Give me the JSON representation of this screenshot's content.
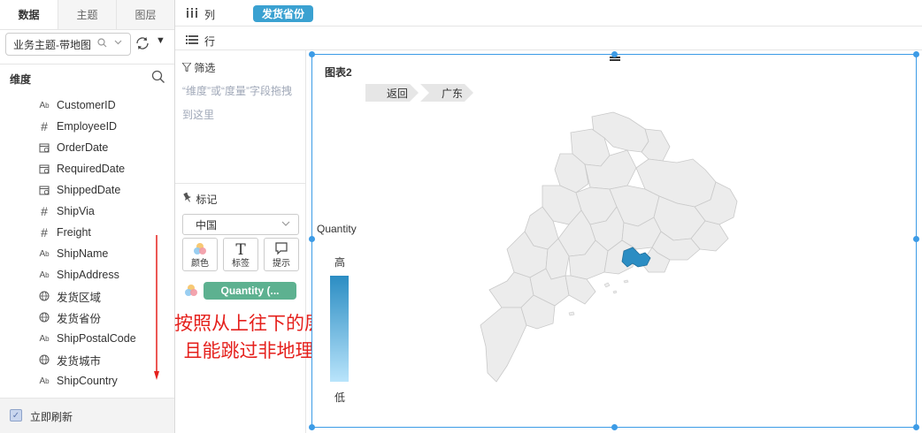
{
  "tabs": [
    "数据",
    "主题",
    "图层"
  ],
  "theme_select": {
    "value": "业务主题-带地图"
  },
  "dimension_header": "维度",
  "fields": [
    {
      "icon": "text-field-icon",
      "glyph": "Ab",
      "name": "CustomerID"
    },
    {
      "icon": "number-field-icon",
      "glyph": "#",
      "name": "EmployeeID"
    },
    {
      "icon": "date-field-icon",
      "glyph": "cal",
      "name": "OrderDate"
    },
    {
      "icon": "date-field-icon",
      "glyph": "cal",
      "name": "RequiredDate"
    },
    {
      "icon": "date-field-icon",
      "glyph": "cal",
      "name": "ShippedDate"
    },
    {
      "icon": "number-field-icon",
      "glyph": "#",
      "name": "ShipVia"
    },
    {
      "icon": "number-field-icon",
      "glyph": "#",
      "name": "Freight"
    },
    {
      "icon": "text-field-icon",
      "glyph": "Ab",
      "name": "ShipName"
    },
    {
      "icon": "text-field-icon",
      "glyph": "Ab",
      "name": "ShipAddress"
    },
    {
      "icon": "geo-field-icon",
      "glyph": "geo",
      "name": "发货区域"
    },
    {
      "icon": "geo-field-icon",
      "glyph": "geo",
      "name": "发货省份"
    },
    {
      "icon": "text-field-icon",
      "glyph": "Ab",
      "name": "ShipPostalCode"
    },
    {
      "icon": "geo-field-icon",
      "glyph": "geo",
      "name": "发货城市"
    },
    {
      "icon": "text-field-icon",
      "glyph": "Ab",
      "name": "ShipCountry"
    }
  ],
  "auto_refresh": {
    "label": "立即刷新",
    "checked": true
  },
  "shelves": {
    "columns_label": "列",
    "columns_pill": "发货省份",
    "rows_label": "行"
  },
  "filter": {
    "title": "筛选",
    "hint": "“维度”或“度量”字段拖拽到这里"
  },
  "marks": {
    "title": "标记",
    "select_value": "中国",
    "buttons": [
      "颜色",
      "标签",
      "提示"
    ],
    "quantity_pill": "Quantity (..."
  },
  "annotation": {
    "line1": "按照从上往下的层次下钻，",
    "line2": "且能跳过非地理维字段。",
    "color": "#e5201c"
  },
  "chart": {
    "title": "图表2",
    "breadcrumb": [
      "返回",
      "广东"
    ],
    "legend_title": "Quantity",
    "legend_high": "高",
    "legend_low": "低",
    "highlight_color": "#2b8dc3",
    "base_color": "#ececec"
  }
}
